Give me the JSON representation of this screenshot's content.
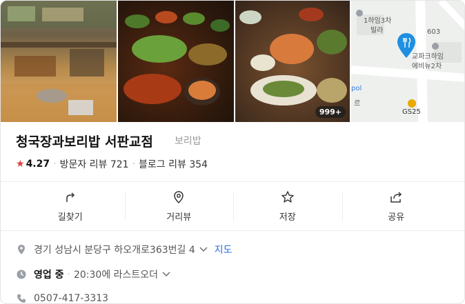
{
  "photos": {
    "photo_count_badge": "999+",
    "map_labels": {
      "l1": "1하임3차",
      "l2": "빌라",
      "l3": "603",
      "l4": "교파크하임",
      "l5": "에비뉴2차",
      "l6": "pol",
      "l7": "르",
      "l8": "GS25"
    }
  },
  "place": {
    "name": "청국장과보리밥 서판교점",
    "category": "보리밥",
    "rating": "4.27",
    "visitor_reviews": "방문자 리뷰 721",
    "blog_reviews": "블로그 리뷰 354"
  },
  "actions": [
    {
      "label": "길찾기",
      "icon": "directions-icon"
    },
    {
      "label": "거리뷰",
      "icon": "street-view-icon"
    },
    {
      "label": "저장",
      "icon": "star-icon"
    },
    {
      "label": "공유",
      "icon": "share-icon"
    }
  ],
  "details": {
    "address": "경기 성남시 분당구 하오개로363번길 4",
    "map_link": "지도",
    "hours_status": "영업 중",
    "hours_detail": "20:30에 라스트오더",
    "phone": "0507-417-3313"
  },
  "colors": {
    "star": "#e23b3b",
    "link": "#2a6de0",
    "map_pin": "#1e8fe1",
    "gs25": "#e8a900"
  }
}
